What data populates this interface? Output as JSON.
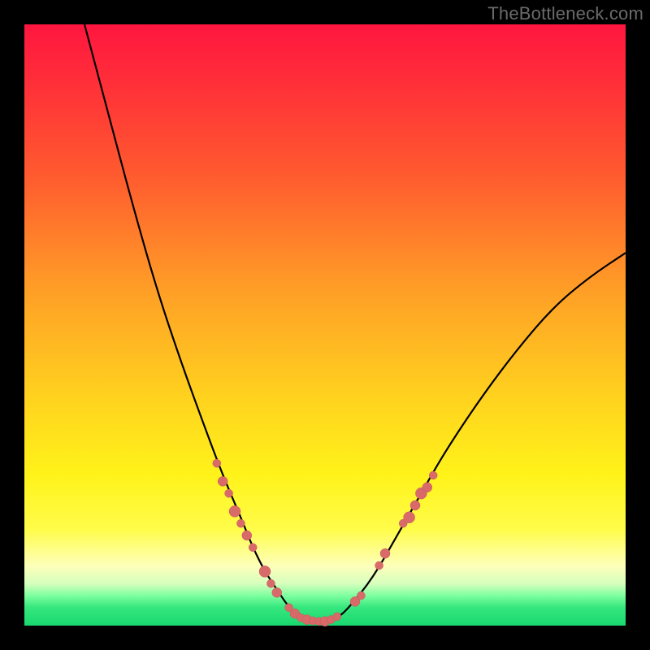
{
  "watermark": "TheBottleneck.com",
  "colors": {
    "frame": "#000000",
    "curve": "#000000",
    "dot_fill": "#d86a6a",
    "dot_stroke": "#c85858",
    "gradient_top": "#ff163f",
    "gradient_bottom": "#19d86f"
  },
  "chart_data": {
    "type": "line",
    "title": "",
    "xlabel": "",
    "ylabel": "",
    "xlim": [
      0,
      100
    ],
    "ylim": [
      0,
      100
    ],
    "grid": false,
    "series": [
      {
        "name": "curve",
        "x": [
          10,
          14,
          18,
          22,
          26,
          30,
          33,
          36,
          38,
          40,
          42,
          44,
          46,
          48,
          50,
          52,
          54,
          58,
          62,
          66,
          70,
          76,
          82,
          88,
          94,
          100
        ],
        "y": [
          100,
          85,
          70,
          56,
          44,
          33,
          25,
          18,
          13,
          9,
          6,
          3,
          1.5,
          0.7,
          0.7,
          1.2,
          3,
          8,
          15,
          22,
          29,
          38,
          46,
          53,
          58,
          62
        ]
      }
    ],
    "markers": {
      "name": "highlight-dots",
      "points": [
        {
          "x": 32,
          "y": 27,
          "r": 5
        },
        {
          "x": 33,
          "y": 24,
          "r": 6
        },
        {
          "x": 34,
          "y": 22,
          "r": 5
        },
        {
          "x": 35,
          "y": 19,
          "r": 7
        },
        {
          "x": 36,
          "y": 17,
          "r": 5
        },
        {
          "x": 37,
          "y": 15,
          "r": 6
        },
        {
          "x": 38,
          "y": 13,
          "r": 5
        },
        {
          "x": 40,
          "y": 9,
          "r": 7
        },
        {
          "x": 41,
          "y": 7,
          "r": 5
        },
        {
          "x": 42,
          "y": 5.5,
          "r": 6
        },
        {
          "x": 44,
          "y": 3,
          "r": 5
        },
        {
          "x": 45,
          "y": 2,
          "r": 6
        },
        {
          "x": 46,
          "y": 1.3,
          "r": 5
        },
        {
          "x": 47,
          "y": 1.0,
          "r": 6
        },
        {
          "x": 48,
          "y": 0.8,
          "r": 5
        },
        {
          "x": 49,
          "y": 0.7,
          "r": 5
        },
        {
          "x": 50,
          "y": 0.7,
          "r": 6
        },
        {
          "x": 51,
          "y": 1.0,
          "r": 5
        },
        {
          "x": 52,
          "y": 1.5,
          "r": 5
        },
        {
          "x": 55,
          "y": 4,
          "r": 6
        },
        {
          "x": 56,
          "y": 5,
          "r": 5
        },
        {
          "x": 59,
          "y": 10,
          "r": 5
        },
        {
          "x": 60,
          "y": 12,
          "r": 6
        },
        {
          "x": 63,
          "y": 17,
          "r": 5
        },
        {
          "x": 64,
          "y": 18,
          "r": 7
        },
        {
          "x": 65,
          "y": 20,
          "r": 6
        },
        {
          "x": 66,
          "y": 22,
          "r": 7
        },
        {
          "x": 67,
          "y": 23,
          "r": 6
        },
        {
          "x": 68,
          "y": 25,
          "r": 5
        }
      ]
    }
  }
}
